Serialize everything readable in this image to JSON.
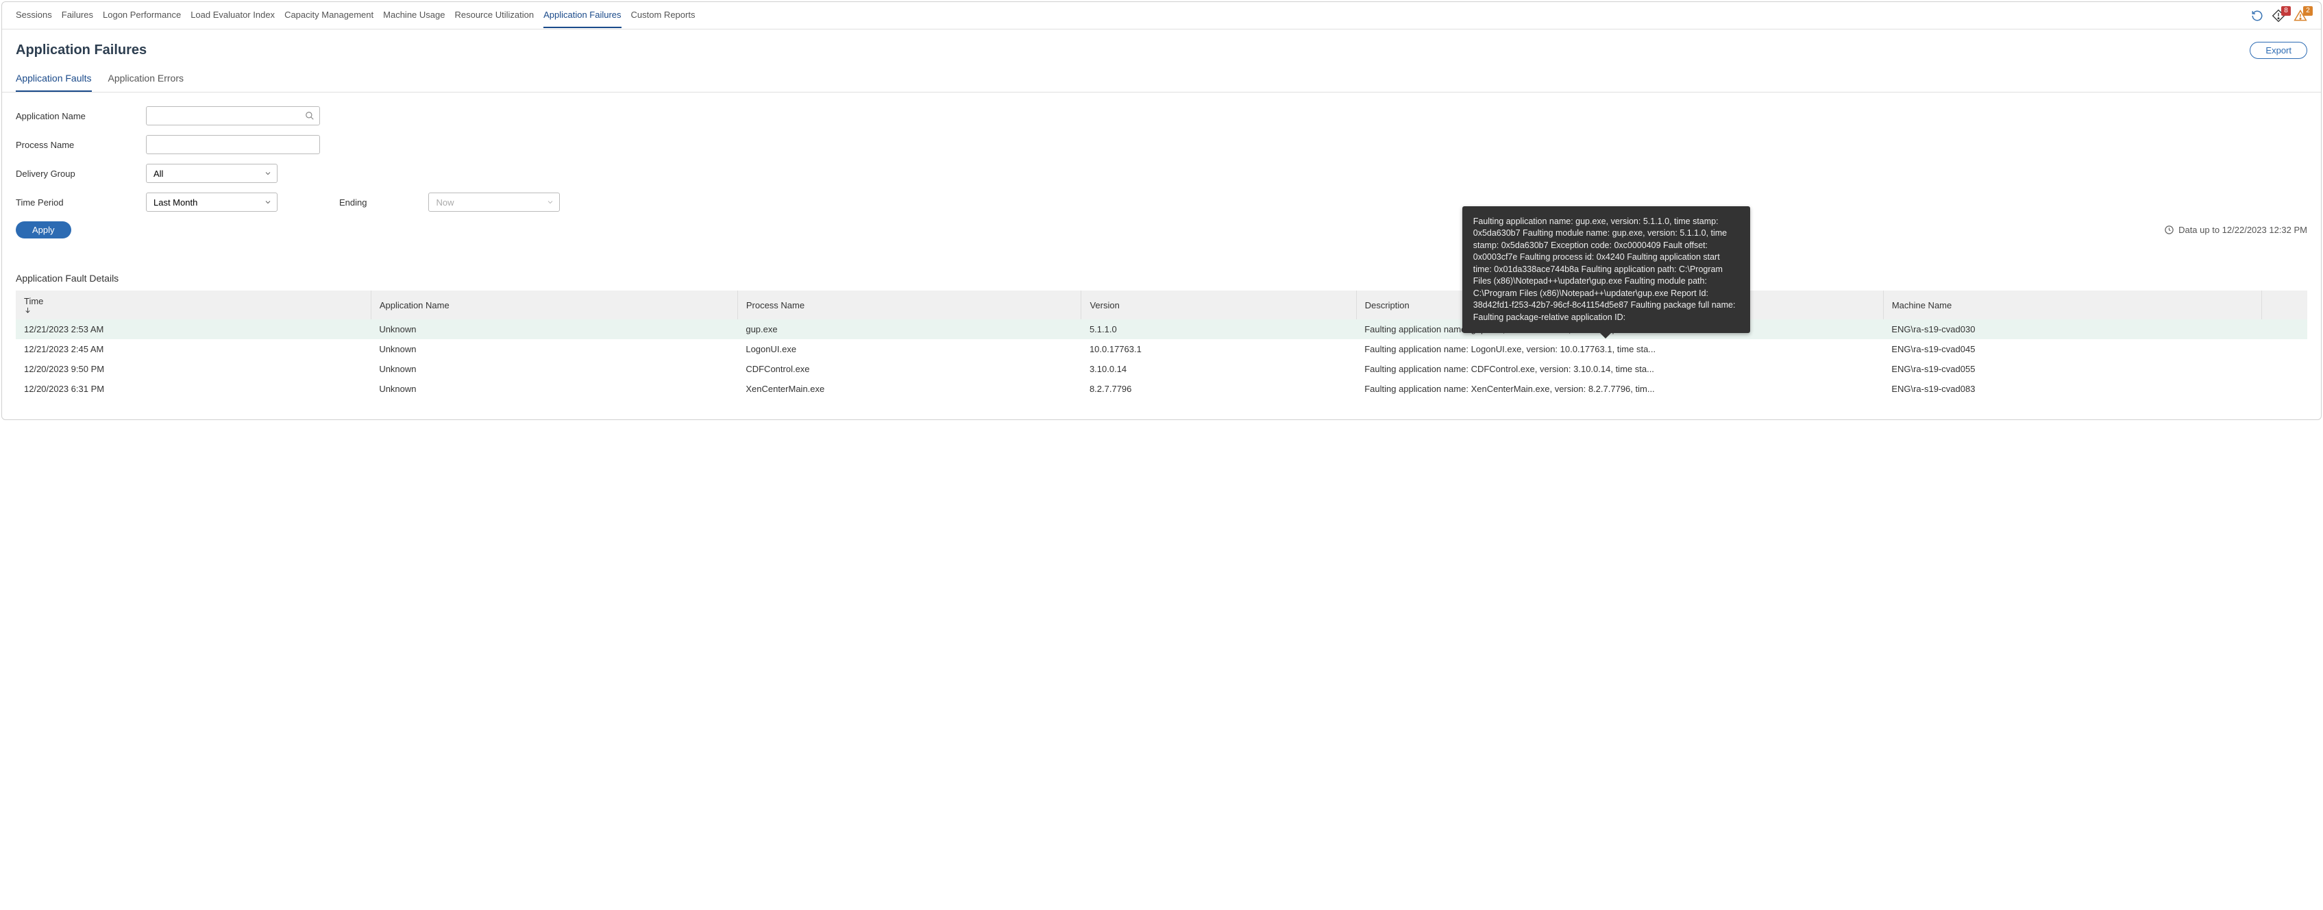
{
  "nav": {
    "tabs": [
      "Sessions",
      "Failures",
      "Logon Performance",
      "Load Evaluator Index",
      "Capacity Management",
      "Machine Usage",
      "Resource Utilization",
      "Application Failures",
      "Custom Reports"
    ],
    "active": "Application Failures",
    "badges": {
      "alert": "8",
      "warn": "2"
    }
  },
  "page": {
    "title": "Application Failures",
    "export": "Export"
  },
  "subtabs": {
    "items": [
      "Application Faults",
      "Application Errors"
    ],
    "active": "Application Faults"
  },
  "filters": {
    "app_name_label": "Application Name",
    "process_name_label": "Process Name",
    "delivery_group_label": "Delivery Group",
    "delivery_group_value": "All",
    "time_period_label": "Time Period",
    "time_period_value": "Last Month",
    "ending_label": "Ending",
    "ending_value": "Now",
    "apply": "Apply",
    "data_upto": "Data up to 12/22/2023 12:32 PM"
  },
  "details": {
    "title": "Application Fault Details",
    "columns": [
      "Time",
      "Application Name",
      "Process Name",
      "Version",
      "Description",
      "Machine Name"
    ],
    "rows": [
      {
        "time": "12/21/2023 2:53 AM",
        "app": "Unknown",
        "process": "gup.exe",
        "version": "5.1.1.0",
        "desc": "Faulting application name: gup.exe, version: 5.1.1.0, time stamp: 0x5da6...",
        "machine": "ENG\\ra-s19-cvad030"
      },
      {
        "time": "12/21/2023 2:45 AM",
        "app": "Unknown",
        "process": "LogonUI.exe",
        "version": "10.0.17763.1",
        "desc": "Faulting application name: LogonUI.exe, version: 10.0.17763.1, time sta...",
        "machine": "ENG\\ra-s19-cvad045"
      },
      {
        "time": "12/20/2023 9:50 PM",
        "app": "Unknown",
        "process": "CDFControl.exe",
        "version": "3.10.0.14",
        "desc": "Faulting application name: CDFControl.exe, version: 3.10.0.14, time sta...",
        "machine": "ENG\\ra-s19-cvad055"
      },
      {
        "time": "12/20/2023 6:31 PM",
        "app": "Unknown",
        "process": "XenCenterMain.exe",
        "version": "8.2.7.7796",
        "desc": "Faulting application name: XenCenterMain.exe, version: 8.2.7.7796, tim...",
        "machine": "ENG\\ra-s19-cvad083"
      }
    ]
  },
  "tooltip": "Faulting application name: gup.exe, version: 5.1.1.0, time stamp: 0x5da630b7 Faulting module name: gup.exe, version: 5.1.1.0, time stamp: 0x5da630b7 Exception code: 0xc0000409 Fault offset: 0x0003cf7e Faulting process id: 0x4240 Faulting application start time: 0x01da338ace744b8a Faulting application path: C:\\Program Files (x86)\\Notepad++\\updater\\gup.exe Faulting module path: C:\\Program Files (x86)\\Notepad++\\updater\\gup.exe Report Id: 38d42fd1-f253-42b7-96cf-8c41154d5e87 Faulting package full name: Faulting package-relative application ID:"
}
